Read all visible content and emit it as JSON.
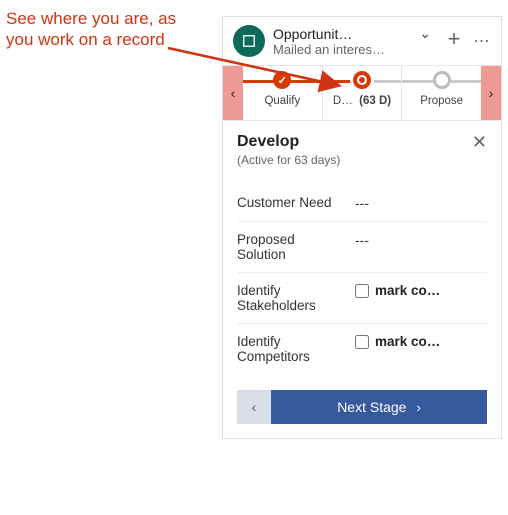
{
  "annotation": "See where you are, as you work on a record",
  "header": {
    "title": "Opportunit…",
    "subtitle": "Mailed an interes…"
  },
  "process": {
    "stages": [
      {
        "label": "Qualify",
        "state": "done"
      },
      {
        "label": "D…",
        "duration": "(63 D)",
        "state": "current"
      },
      {
        "label": "Propose",
        "state": "future"
      }
    ]
  },
  "flyout": {
    "title": "Develop",
    "subtitle": "(Active for 63 days)",
    "fields": [
      {
        "label": "Customer Need",
        "type": "text",
        "value": "---"
      },
      {
        "label": "Proposed Solution",
        "type": "text",
        "value": "---"
      },
      {
        "label": "Identify Stakeholders",
        "type": "check",
        "check_label": "mark co…",
        "checked": false
      },
      {
        "label": "Identify Competitors",
        "type": "check",
        "check_label": "mark co…",
        "checked": false
      }
    ],
    "next_label": "Next Stage"
  }
}
